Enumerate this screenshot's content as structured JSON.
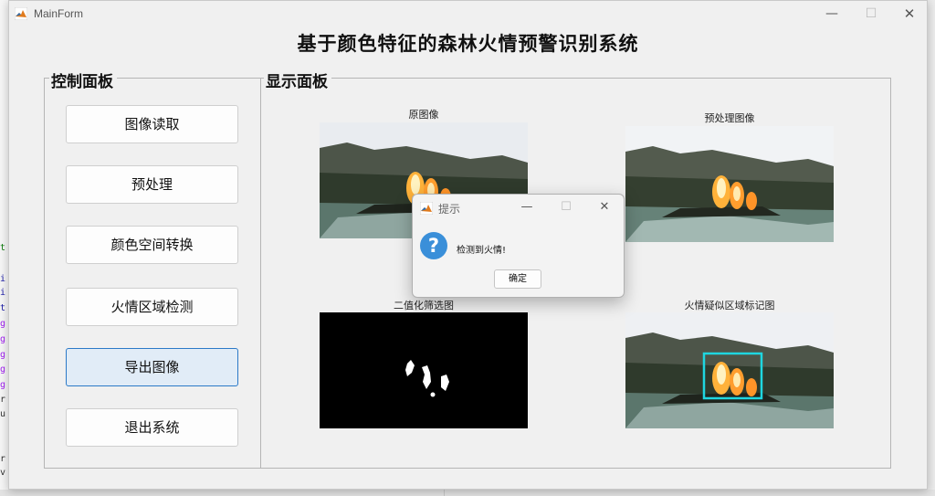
{
  "window": {
    "title": "MainForm"
  },
  "page_title": "基于颜色特征的森林火情预警识别系统",
  "control_panel": {
    "title": "控制面板",
    "buttons": [
      {
        "label": "图像读取"
      },
      {
        "label": "预处理"
      },
      {
        "label": "颜色空间转换"
      },
      {
        "label": "火情区域检测"
      },
      {
        "label": "导出图像"
      },
      {
        "label": "退出系统"
      }
    ],
    "active_button": "导出图像"
  },
  "display_panel": {
    "title": "显示面板",
    "images": {
      "original": "原图像",
      "preprocessed": "预处理图像",
      "binary": "二值化筛选图",
      "marked": "火情疑似区域标记图"
    }
  },
  "dialog": {
    "title": "提示",
    "message": "检测到火情!",
    "ok_label": "确定"
  },
  "colors": {
    "accent": "#2b79c7",
    "active_button_bg": "#e1ecf7",
    "marker_box": "#1fd6e0",
    "info_icon": "#3a8fd9"
  },
  "icons": {
    "app": "matlab-logo-icon",
    "dialog_info": "question-icon"
  }
}
